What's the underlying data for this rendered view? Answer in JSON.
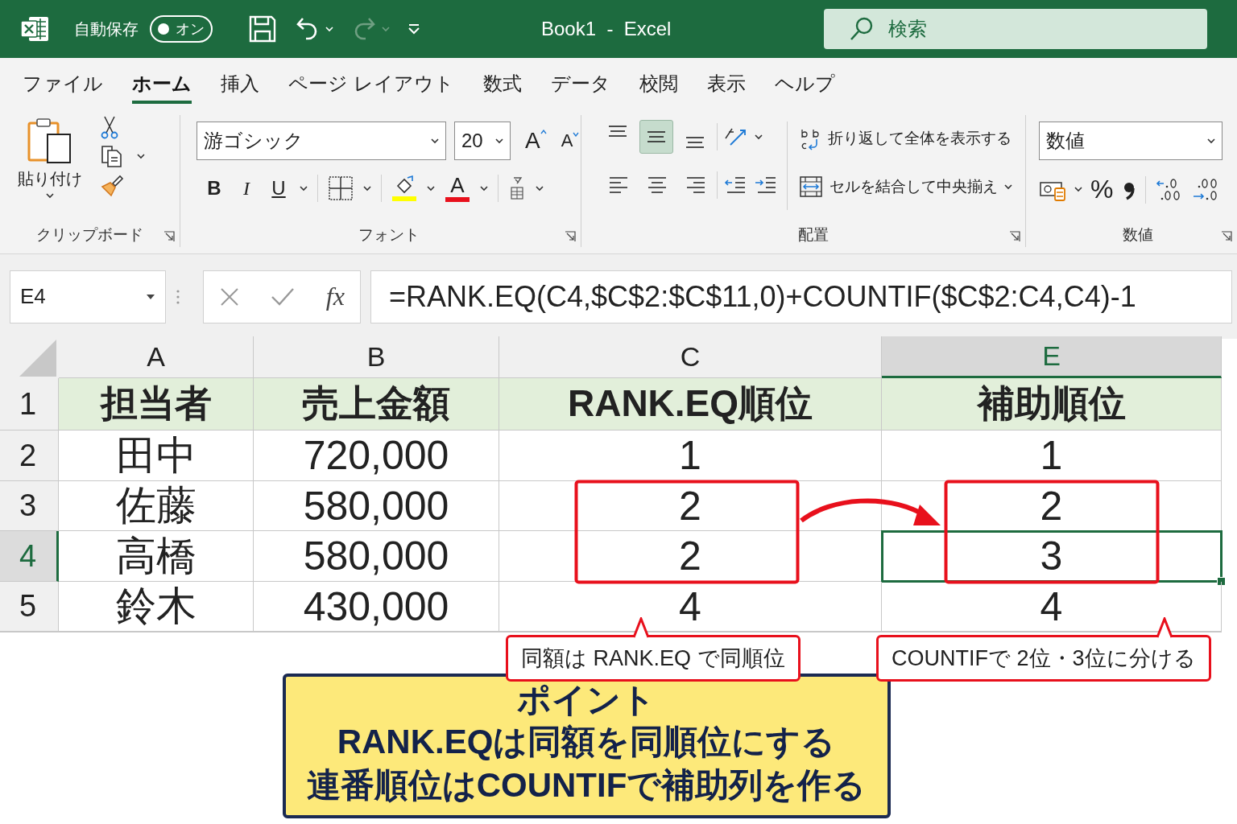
{
  "title_bar": {
    "autosave_label": "自動保存",
    "autosave_toggle": {
      "label": "オン",
      "on": true
    },
    "quick_access": [
      {
        "kind": "save",
        "disabled": false
      },
      {
        "kind": "undo",
        "disabled": false
      },
      {
        "kind": "redo",
        "disabled": true
      },
      {
        "kind": "customize",
        "disabled": false
      }
    ],
    "title": "Book1  -  Excel",
    "search": {
      "placeholder": "検索"
    }
  },
  "tabs": [
    {
      "label": "ファイル",
      "selected": false
    },
    {
      "label": "ホーム",
      "selected": true
    },
    {
      "label": "挿入",
      "selected": false
    },
    {
      "label": "ページ レイアウト",
      "selected": false
    },
    {
      "label": "数式",
      "selected": false
    },
    {
      "label": "データ",
      "selected": false
    },
    {
      "label": "校閲",
      "selected": false
    },
    {
      "label": "表示",
      "selected": false
    },
    {
      "label": "ヘルプ",
      "selected": false
    }
  ],
  "ribbon": {
    "clipboard": {
      "paste_label": "貼り付け",
      "group_label": "クリップボード"
    },
    "font": {
      "font_name": "游ゴシック",
      "font_size": "20",
      "grow": "A",
      "shrink": "A",
      "bold": "B",
      "italic": "I",
      "underline": "U",
      "font_color": "A",
      "group_label": "フォント"
    },
    "alignment": {
      "vertical": [
        {
          "kind": "top",
          "selected": false
        },
        {
          "kind": "middle",
          "selected": true
        },
        {
          "kind": "bottom",
          "selected": false
        }
      ],
      "horizontal": [
        {
          "kind": "left",
          "selected": false
        },
        {
          "kind": "center",
          "selected": false
        },
        {
          "kind": "right",
          "selected": false
        }
      ],
      "wrap_text": "折り返して全体を表示する",
      "merge": "セルを結合して中央揃え",
      "group_label": "配置"
    },
    "number": {
      "format": "数値",
      "percent": "%",
      "group_label": "数値"
    }
  },
  "formula_bar": {
    "name_box": "E4",
    "fx": "fx",
    "formula": "=RANK.EQ(C4,$C$2:$C$11,0)+COUNTIF($C$2:C4,C4)-1"
  },
  "sheet": {
    "columns": [
      {
        "label": "A",
        "selected": false
      },
      {
        "label": "B",
        "selected": false
      },
      {
        "label": "C",
        "selected": false
      },
      {
        "label": "E",
        "selected": true
      }
    ],
    "rows": [
      {
        "header": "1",
        "selected": false,
        "kind": "header",
        "cells": [
          {
            "text": "担当者",
            "active": false
          },
          {
            "text": "売上金額",
            "active": false
          },
          {
            "text": "RANK.EQ順位",
            "active": false
          },
          {
            "text": "補助順位",
            "active": false
          }
        ]
      },
      {
        "header": "2",
        "selected": false,
        "kind": "data",
        "cells": [
          {
            "text": "田中",
            "active": false
          },
          {
            "text": "720,000",
            "active": false
          },
          {
            "text": "1",
            "active": false
          },
          {
            "text": "1",
            "active": false
          }
        ]
      },
      {
        "header": "3",
        "selected": false,
        "kind": "data",
        "cells": [
          {
            "text": "佐藤",
            "active": false
          },
          {
            "text": "580,000",
            "active": false
          },
          {
            "text": "2",
            "active": false
          },
          {
            "text": "2",
            "active": false
          }
        ]
      },
      {
        "header": "4",
        "selected": true,
        "kind": "data",
        "cells": [
          {
            "text": "高橋",
            "active": false
          },
          {
            "text": "580,000",
            "active": false
          },
          {
            "text": "2",
            "active": false
          },
          {
            "text": "3",
            "active": true
          }
        ]
      },
      {
        "header": "5",
        "selected": false,
        "kind": "data",
        "cells": [
          {
            "text": "鈴木",
            "active": false
          },
          {
            "text": "430,000",
            "active": false
          },
          {
            "text": "4",
            "active": false
          },
          {
            "text": "4",
            "active": false
          }
        ]
      }
    ]
  },
  "annotations": {
    "callouts": [
      "同額は RANK.EQ で同順位",
      "COUNTIFで 2位・3位に分ける"
    ],
    "point": {
      "title": "ポイント",
      "lines": [
        "RANK.EQは同額を同順位にする",
        "連番順位はCOUNTIFで補助列を作る"
      ]
    }
  }
}
